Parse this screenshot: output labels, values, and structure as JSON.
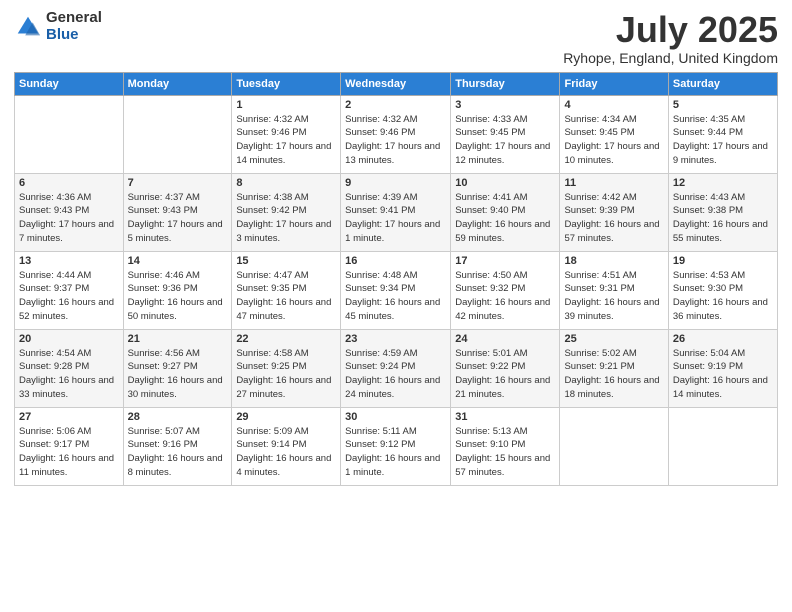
{
  "logo": {
    "general": "General",
    "blue": "Blue"
  },
  "header": {
    "title": "July 2025",
    "subtitle": "Ryhope, England, United Kingdom"
  },
  "days_of_week": [
    "Sunday",
    "Monday",
    "Tuesday",
    "Wednesday",
    "Thursday",
    "Friday",
    "Saturday"
  ],
  "weeks": [
    [
      {
        "day": "",
        "info": ""
      },
      {
        "day": "",
        "info": ""
      },
      {
        "day": "1",
        "info": "Sunrise: 4:32 AM\nSunset: 9:46 PM\nDaylight: 17 hours and 14 minutes."
      },
      {
        "day": "2",
        "info": "Sunrise: 4:32 AM\nSunset: 9:46 PM\nDaylight: 17 hours and 13 minutes."
      },
      {
        "day": "3",
        "info": "Sunrise: 4:33 AM\nSunset: 9:45 PM\nDaylight: 17 hours and 12 minutes."
      },
      {
        "day": "4",
        "info": "Sunrise: 4:34 AM\nSunset: 9:45 PM\nDaylight: 17 hours and 10 minutes."
      },
      {
        "day": "5",
        "info": "Sunrise: 4:35 AM\nSunset: 9:44 PM\nDaylight: 17 hours and 9 minutes."
      }
    ],
    [
      {
        "day": "6",
        "info": "Sunrise: 4:36 AM\nSunset: 9:43 PM\nDaylight: 17 hours and 7 minutes."
      },
      {
        "day": "7",
        "info": "Sunrise: 4:37 AM\nSunset: 9:43 PM\nDaylight: 17 hours and 5 minutes."
      },
      {
        "day": "8",
        "info": "Sunrise: 4:38 AM\nSunset: 9:42 PM\nDaylight: 17 hours and 3 minutes."
      },
      {
        "day": "9",
        "info": "Sunrise: 4:39 AM\nSunset: 9:41 PM\nDaylight: 17 hours and 1 minute."
      },
      {
        "day": "10",
        "info": "Sunrise: 4:41 AM\nSunset: 9:40 PM\nDaylight: 16 hours and 59 minutes."
      },
      {
        "day": "11",
        "info": "Sunrise: 4:42 AM\nSunset: 9:39 PM\nDaylight: 16 hours and 57 minutes."
      },
      {
        "day": "12",
        "info": "Sunrise: 4:43 AM\nSunset: 9:38 PM\nDaylight: 16 hours and 55 minutes."
      }
    ],
    [
      {
        "day": "13",
        "info": "Sunrise: 4:44 AM\nSunset: 9:37 PM\nDaylight: 16 hours and 52 minutes."
      },
      {
        "day": "14",
        "info": "Sunrise: 4:46 AM\nSunset: 9:36 PM\nDaylight: 16 hours and 50 minutes."
      },
      {
        "day": "15",
        "info": "Sunrise: 4:47 AM\nSunset: 9:35 PM\nDaylight: 16 hours and 47 minutes."
      },
      {
        "day": "16",
        "info": "Sunrise: 4:48 AM\nSunset: 9:34 PM\nDaylight: 16 hours and 45 minutes."
      },
      {
        "day": "17",
        "info": "Sunrise: 4:50 AM\nSunset: 9:32 PM\nDaylight: 16 hours and 42 minutes."
      },
      {
        "day": "18",
        "info": "Sunrise: 4:51 AM\nSunset: 9:31 PM\nDaylight: 16 hours and 39 minutes."
      },
      {
        "day": "19",
        "info": "Sunrise: 4:53 AM\nSunset: 9:30 PM\nDaylight: 16 hours and 36 minutes."
      }
    ],
    [
      {
        "day": "20",
        "info": "Sunrise: 4:54 AM\nSunset: 9:28 PM\nDaylight: 16 hours and 33 minutes."
      },
      {
        "day": "21",
        "info": "Sunrise: 4:56 AM\nSunset: 9:27 PM\nDaylight: 16 hours and 30 minutes."
      },
      {
        "day": "22",
        "info": "Sunrise: 4:58 AM\nSunset: 9:25 PM\nDaylight: 16 hours and 27 minutes."
      },
      {
        "day": "23",
        "info": "Sunrise: 4:59 AM\nSunset: 9:24 PM\nDaylight: 16 hours and 24 minutes."
      },
      {
        "day": "24",
        "info": "Sunrise: 5:01 AM\nSunset: 9:22 PM\nDaylight: 16 hours and 21 minutes."
      },
      {
        "day": "25",
        "info": "Sunrise: 5:02 AM\nSunset: 9:21 PM\nDaylight: 16 hours and 18 minutes."
      },
      {
        "day": "26",
        "info": "Sunrise: 5:04 AM\nSunset: 9:19 PM\nDaylight: 16 hours and 14 minutes."
      }
    ],
    [
      {
        "day": "27",
        "info": "Sunrise: 5:06 AM\nSunset: 9:17 PM\nDaylight: 16 hours and 11 minutes."
      },
      {
        "day": "28",
        "info": "Sunrise: 5:07 AM\nSunset: 9:16 PM\nDaylight: 16 hours and 8 minutes."
      },
      {
        "day": "29",
        "info": "Sunrise: 5:09 AM\nSunset: 9:14 PM\nDaylight: 16 hours and 4 minutes."
      },
      {
        "day": "30",
        "info": "Sunrise: 5:11 AM\nSunset: 9:12 PM\nDaylight: 16 hours and 1 minute."
      },
      {
        "day": "31",
        "info": "Sunrise: 5:13 AM\nSunset: 9:10 PM\nDaylight: 15 hours and 57 minutes."
      },
      {
        "day": "",
        "info": ""
      },
      {
        "day": "",
        "info": ""
      }
    ]
  ]
}
